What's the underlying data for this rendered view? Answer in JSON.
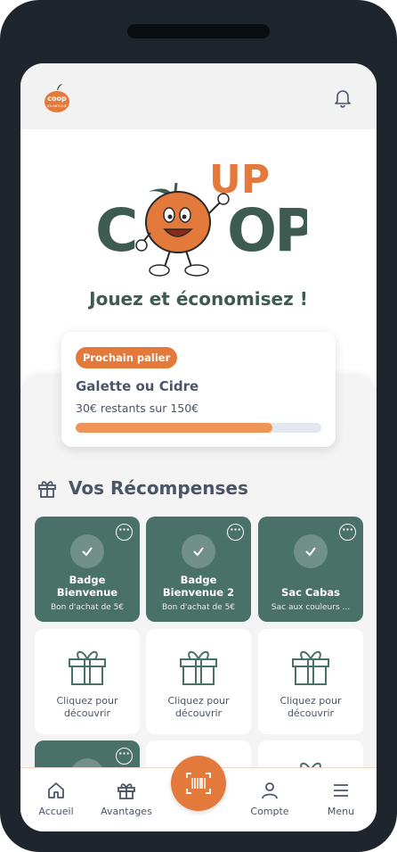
{
  "header": {
    "logo_text": "coop",
    "logo_subtext": "ATLANTIQUE",
    "bell_icon": "bell-icon"
  },
  "hero": {
    "logo_word_up": "UP",
    "logo_word_coop": "COOP",
    "tagline": "Jouez et économisez !"
  },
  "next_tier": {
    "badge": "Prochain palier",
    "title": "Galette ou Cidre",
    "remaining_text": "30€ restants sur 150€",
    "progress_fraction": 0.8
  },
  "rewards": {
    "title": "Vos Récompenses",
    "completed": [
      {
        "title": "Badge\nBienvenue",
        "subtitle": "Bon d'achat de 5€"
      },
      {
        "title": "Badge\nBienvenue 2",
        "subtitle": "Bon d'achat de 5€"
      },
      {
        "title": "Sac Cabas",
        "subtitle": "Sac aux couleurs ..."
      }
    ],
    "locked_label": "Cliquez pour\ndécouvrir"
  },
  "nav": {
    "items": [
      "Accueil",
      "Avantages",
      "Compte",
      "Menu"
    ]
  },
  "colors": {
    "accent": "#e4793c",
    "brand_green": "#3e5b52",
    "tile_green": "#4a7168",
    "progress": "#ef9459"
  }
}
